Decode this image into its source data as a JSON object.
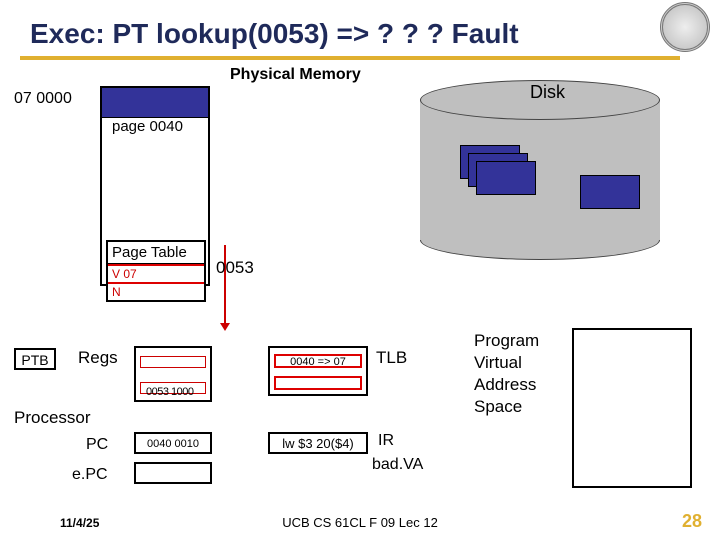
{
  "title": "Exec: PT lookup(0053) => ? ? ? Fault",
  "physical_memory": {
    "label": "Physical Memory",
    "base_addr": "07 0000",
    "page_label": "page 0040"
  },
  "page_table": {
    "title": "Page Table",
    "rows": [
      "V  07",
      "N"
    ],
    "lookup_addr": "0053"
  },
  "disk": {
    "label": "Disk"
  },
  "processor": {
    "label": "Processor",
    "ptb_label": "PTB",
    "regs_label": "Regs",
    "regs_value": "0053 1000",
    "pc_label": "PC",
    "pc_value": "0040 0010",
    "epc_label": "e.PC"
  },
  "tlb": {
    "label": "TLB",
    "entry": "0040 => 07"
  },
  "ir": {
    "label": "IR",
    "value": "lw $3 20($4)",
    "badva": "bad.VA"
  },
  "pvas": {
    "label": "Program\nVirtual\nAddress\nSpace"
  },
  "footer": {
    "date": "11/4/25",
    "center": "UCB CS 61CL F 09 Lec 12",
    "num": "28"
  }
}
